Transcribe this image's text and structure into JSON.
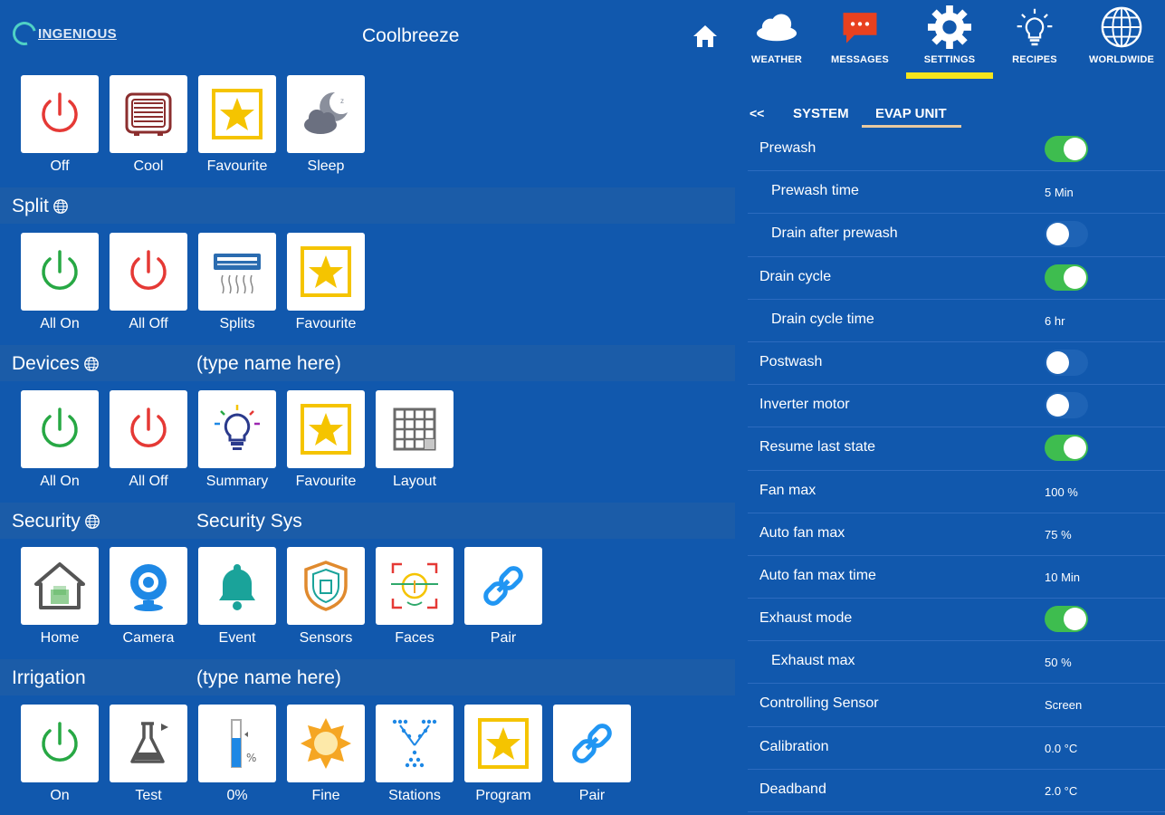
{
  "header": {
    "logo_text": "INGENIOUS",
    "title": "Coolbreeze"
  },
  "mode_row": [
    {
      "label": "Off",
      "icon": "power-icon",
      "color": "#e53935"
    },
    {
      "label": "Cool",
      "icon": "cooler-icon",
      "color": "#8b2e2e"
    },
    {
      "label": "Favourite",
      "icon": "star-icon",
      "color": "#f5c400"
    },
    {
      "label": "Sleep",
      "icon": "moon-cloud-icon",
      "color": "#6b7080"
    }
  ],
  "sections": {
    "split": {
      "title": "Split",
      "tiles": [
        {
          "label": "All On",
          "icon": "power-icon",
          "color": "#27a844"
        },
        {
          "label": "All Off",
          "icon": "power-icon",
          "color": "#e53935"
        },
        {
          "label": "Splits",
          "icon": "split-ac-icon",
          "color": "#2b6cb0"
        },
        {
          "label": "Favourite",
          "icon": "star-icon",
          "color": "#f5c400"
        }
      ]
    },
    "devices": {
      "title": "Devices",
      "subtitle": "(type name here)",
      "tiles": [
        {
          "label": "All On",
          "icon": "power-icon",
          "color": "#27a844"
        },
        {
          "label": "All Off",
          "icon": "power-icon",
          "color": "#e53935"
        },
        {
          "label": "Summary",
          "icon": "lightbulb-icon",
          "color": "#2a3a8c"
        },
        {
          "label": "Favourite",
          "icon": "star-icon",
          "color": "#f5c400"
        },
        {
          "label": "Layout",
          "icon": "grid-icon",
          "color": "#6b6b6b"
        }
      ]
    },
    "security": {
      "title": "Security",
      "subtitle": "Security Sys",
      "tiles": [
        {
          "label": "Home",
          "icon": "house-icon",
          "color": "#555555"
        },
        {
          "label": "Camera",
          "icon": "webcam-icon",
          "color": "#1e88e5"
        },
        {
          "label": "Event",
          "icon": "bell-icon",
          "color": "#1aa39a"
        },
        {
          "label": "Sensors",
          "icon": "shield-icon",
          "color": "#e08a2e"
        },
        {
          "label": "Faces",
          "icon": "face-scan-icon",
          "color": "#2fa86b"
        },
        {
          "label": "Pair",
          "icon": "link-icon",
          "color": "#2196f3"
        }
      ]
    },
    "irrigation": {
      "title": "Irrigation",
      "subtitle": "(type name here)",
      "tiles": [
        {
          "label": "On",
          "icon": "power-icon",
          "color": "#27a844"
        },
        {
          "label": "Test",
          "icon": "flask-icon",
          "color": "#555555"
        },
        {
          "label": "0%",
          "icon": "gauge-icon",
          "color": "#1e88e5"
        },
        {
          "label": "Fine",
          "icon": "sun-icon",
          "color": "#f5a623"
        },
        {
          "label": "Stations",
          "icon": "sprinkler-icon",
          "color": "#1e88e5"
        },
        {
          "label": "Program",
          "icon": "star-icon",
          "color": "#f5c400"
        },
        {
          "label": "Pair",
          "icon": "link-icon",
          "color": "#2196f3"
        }
      ]
    }
  },
  "topnav": [
    {
      "label": "WEATHER",
      "icon": "cloud-icon"
    },
    {
      "label": "MESSAGES",
      "icon": "message-icon"
    },
    {
      "label": "SETTINGS",
      "icon": "gear-icon",
      "active": true
    },
    {
      "label": "RECIPES",
      "icon": "lightbulb-outline-icon"
    },
    {
      "label": "WORLDWIDE",
      "icon": "globe-icon"
    }
  ],
  "subtabs": {
    "back": "<<",
    "system": "SYSTEM",
    "evap": "EVAP UNIT"
  },
  "settings": [
    {
      "label": "Prewash",
      "type": "toggle",
      "on": true,
      "indent": false
    },
    {
      "label": "Prewash time",
      "type": "value",
      "value": "5 Min",
      "indent": true
    },
    {
      "label": "Drain after prewash",
      "type": "toggle",
      "on": false,
      "indent": true
    },
    {
      "label": "Drain cycle",
      "type": "toggle",
      "on": true,
      "indent": false
    },
    {
      "label": "Drain cycle time",
      "type": "value",
      "value": "6 hr",
      "indent": true
    },
    {
      "label": "Postwash",
      "type": "toggle",
      "on": false,
      "indent": false
    },
    {
      "label": "Inverter motor",
      "type": "toggle",
      "on": false,
      "indent": false
    },
    {
      "label": "Resume last state",
      "type": "toggle",
      "on": true,
      "indent": false
    },
    {
      "label": "Fan max",
      "type": "value",
      "value": "100 %",
      "indent": false
    },
    {
      "label": "Auto fan max",
      "type": "value",
      "value": "75 %",
      "indent": false
    },
    {
      "label": "Auto fan max time",
      "type": "value",
      "value": "10 Min",
      "indent": false
    },
    {
      "label": "Exhaust mode",
      "type": "toggle",
      "on": true,
      "indent": false
    },
    {
      "label": "Exhaust max",
      "type": "value",
      "value": "50 %",
      "indent": true
    },
    {
      "label": "Controlling Sensor",
      "type": "value",
      "value": "Screen",
      "indent": false
    },
    {
      "label": "Calibration",
      "type": "value",
      "value": "0.0 °C",
      "indent": false
    },
    {
      "label": "Deadband",
      "type": "value",
      "value": "2.0 °C",
      "indent": false
    }
  ],
  "colors": {
    "background": "#1158ad",
    "toggle_on": "#3ebd4f",
    "nav_underline": "#f5e51b"
  }
}
